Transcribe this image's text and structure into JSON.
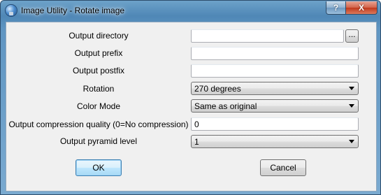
{
  "window": {
    "title": "Image Utility - Rotate image",
    "help_label": "?",
    "close_label": "X"
  },
  "form": {
    "output_directory": {
      "label": "Output directory",
      "value": "",
      "browse_label": "..."
    },
    "output_prefix": {
      "label": "Output prefix",
      "value": ""
    },
    "output_postfix": {
      "label": "Output postfix",
      "value": ""
    },
    "rotation": {
      "label": "Rotation",
      "value": "270 degrees"
    },
    "color_mode": {
      "label": "Color Mode",
      "value": "Same as original"
    },
    "compression_quality": {
      "label": "Output compression quality (0=No compression)",
      "value": "0"
    },
    "pyramid_level": {
      "label": "Output pyramid level",
      "value": "1"
    }
  },
  "buttons": {
    "ok_label": "OK",
    "cancel_label": "Cancel"
  }
}
